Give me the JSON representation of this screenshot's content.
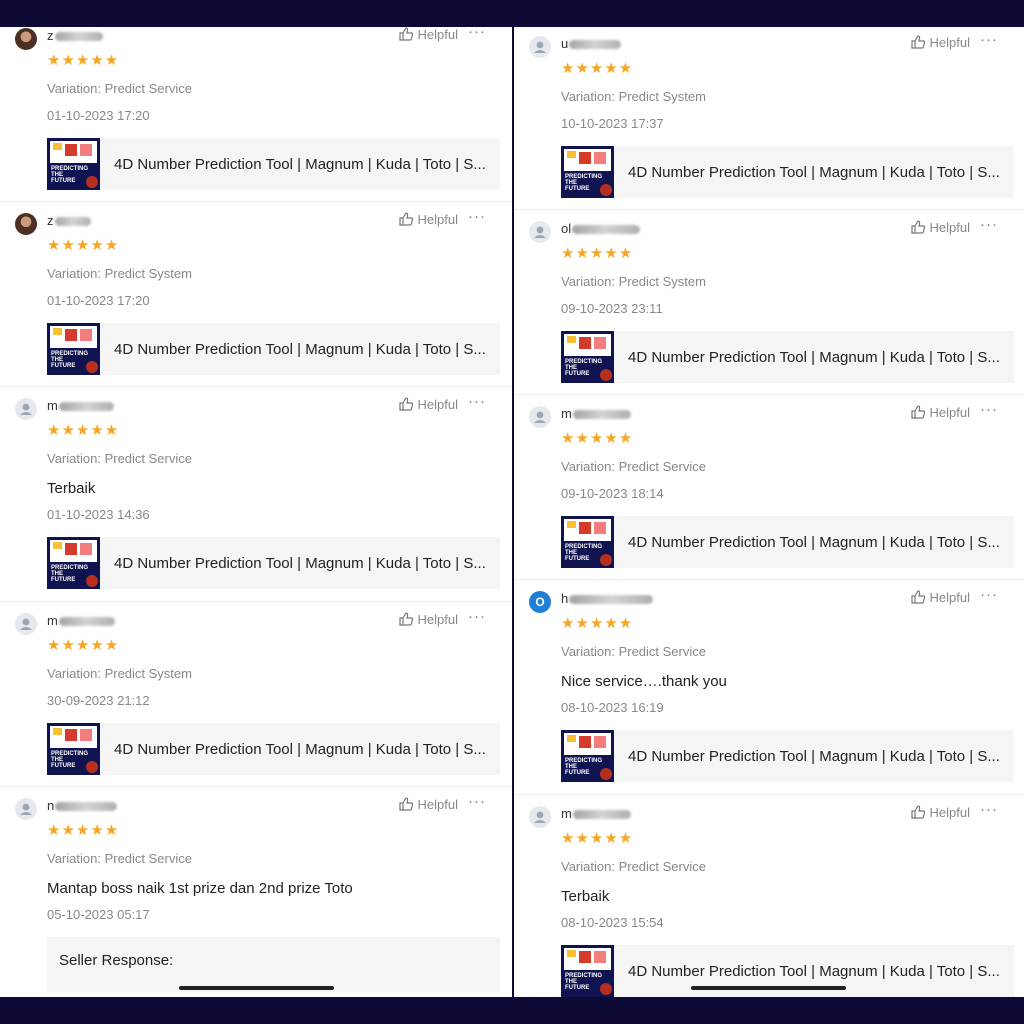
{
  "helpful_label": "Helpful",
  "more_label": "···",
  "stars": "★★★★★",
  "product_title": "4D Number Prediction Tool | Magnum | Kuda | Toto | S...",
  "thumb_text": "PREDICTING THE FUTURE",
  "left": [
    {
      "user": "z",
      "blur": 48,
      "avatar": "photo",
      "variation": "Variation: Predict Service",
      "comment": "",
      "date": "01-10-2023 17:20"
    },
    {
      "user": "z",
      "blur": 36,
      "avatar": "photo",
      "variation": "Variation: Predict System",
      "comment": "",
      "date": "01-10-2023 17:20"
    },
    {
      "user": "m",
      "blur": 55,
      "avatar": "default",
      "variation": "Variation: Predict Service",
      "comment": "Terbaik",
      "date": "01-10-2023 14:36"
    },
    {
      "user": "m",
      "blur": 56,
      "avatar": "default",
      "variation": "Variation: Predict System",
      "comment": "",
      "date": "30-09-2023 21:12"
    },
    {
      "user": "n",
      "blur": 62,
      "avatar": "default",
      "variation": "Variation: Predict Service",
      "comment": "Mantap boss naik 1st prize dan 2nd prize Toto",
      "date": "05-10-2023 05:17",
      "seller": "Seller Response:"
    }
  ],
  "right": [
    {
      "user": "u",
      "blur": 52,
      "avatar": "default",
      "variation": "Variation: Predict System",
      "comment": "",
      "date": "10-10-2023 17:37"
    },
    {
      "user": "ol",
      "blur": 68,
      "avatar": "default",
      "variation": "Variation: Predict System",
      "comment": "",
      "date": "09-10-2023 23:11"
    },
    {
      "user": "m",
      "blur": 58,
      "avatar": "default",
      "variation": "Variation: Predict Service",
      "comment": "",
      "date": "09-10-2023 18:14"
    },
    {
      "user": "h",
      "blur": 84,
      "avatar": "letter",
      "avatar_letter": "O",
      "variation": "Variation: Predict Service",
      "comment": "Nice service….thank you",
      "date": "08-10-2023 16:19"
    },
    {
      "user": "m",
      "blur": 58,
      "avatar": "default",
      "variation": "Variation: Predict Service",
      "comment": "Terbaik",
      "date": "08-10-2023 15:54"
    }
  ]
}
